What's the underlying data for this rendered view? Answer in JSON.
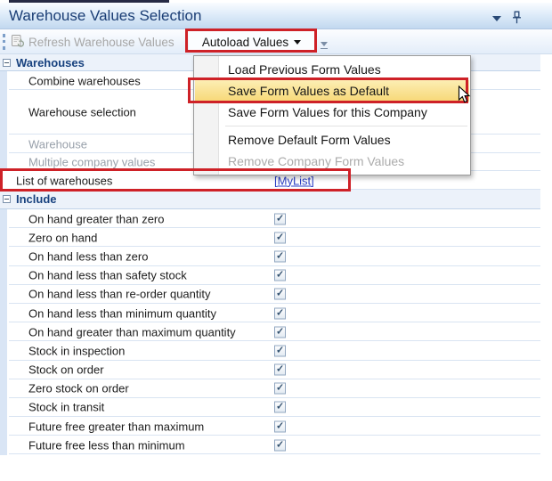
{
  "panel": {
    "title": "Warehouse Values Selection"
  },
  "toolbar": {
    "refresh_label": "Refresh Warehouse Values",
    "autoload_label": "Autoload Values"
  },
  "menu": {
    "items": [
      "Load Previous Form Values",
      "Save Form Values as Default",
      "Save Form Values for this Company",
      "Remove Default Form Values",
      "Remove Company Form Values"
    ],
    "highlighted_item": "Save Form Values as Default",
    "disabled_item": "Remove Company Form Values"
  },
  "sections": [
    {
      "title": "Warehouses",
      "rows": [
        {
          "label": "Combine warehouses"
        },
        {
          "label": "Warehouse selection"
        },
        {
          "label": "Warehouse",
          "disabled": true
        },
        {
          "label": "Multiple company values",
          "disabled": true
        },
        {
          "label": "List of warehouses",
          "value": "[MyList]"
        }
      ]
    },
    {
      "title": "Include",
      "rows": [
        {
          "label": "On hand greater than zero",
          "checked": true
        },
        {
          "label": "Zero on hand",
          "checked": true
        },
        {
          "label": "On hand less than zero",
          "checked": true
        },
        {
          "label": "On hand less than safety stock",
          "checked": true
        },
        {
          "label": "On hand less than re-order quantity",
          "checked": true
        },
        {
          "label": "On hand less than minimum quantity",
          "checked": true
        },
        {
          "label": "On hand greater than maximum quantity",
          "checked": true
        },
        {
          "label": "Stock in inspection",
          "checked": true
        },
        {
          "label": "Stock on order",
          "checked": true
        },
        {
          "label": "Zero stock on order",
          "checked": true
        },
        {
          "label": "Stock in transit",
          "checked": true
        },
        {
          "label": "Future free greater than maximum",
          "checked": true
        },
        {
          "label": "Future free less than minimum",
          "checked": true
        }
      ]
    }
  ],
  "colors": {
    "annotation_red": "#ce2127",
    "menu_highlight": "#f7d877",
    "link_blue": "#2b3fc4",
    "section_header_blue": "#17417e",
    "title_blue": "#1b3e75"
  }
}
